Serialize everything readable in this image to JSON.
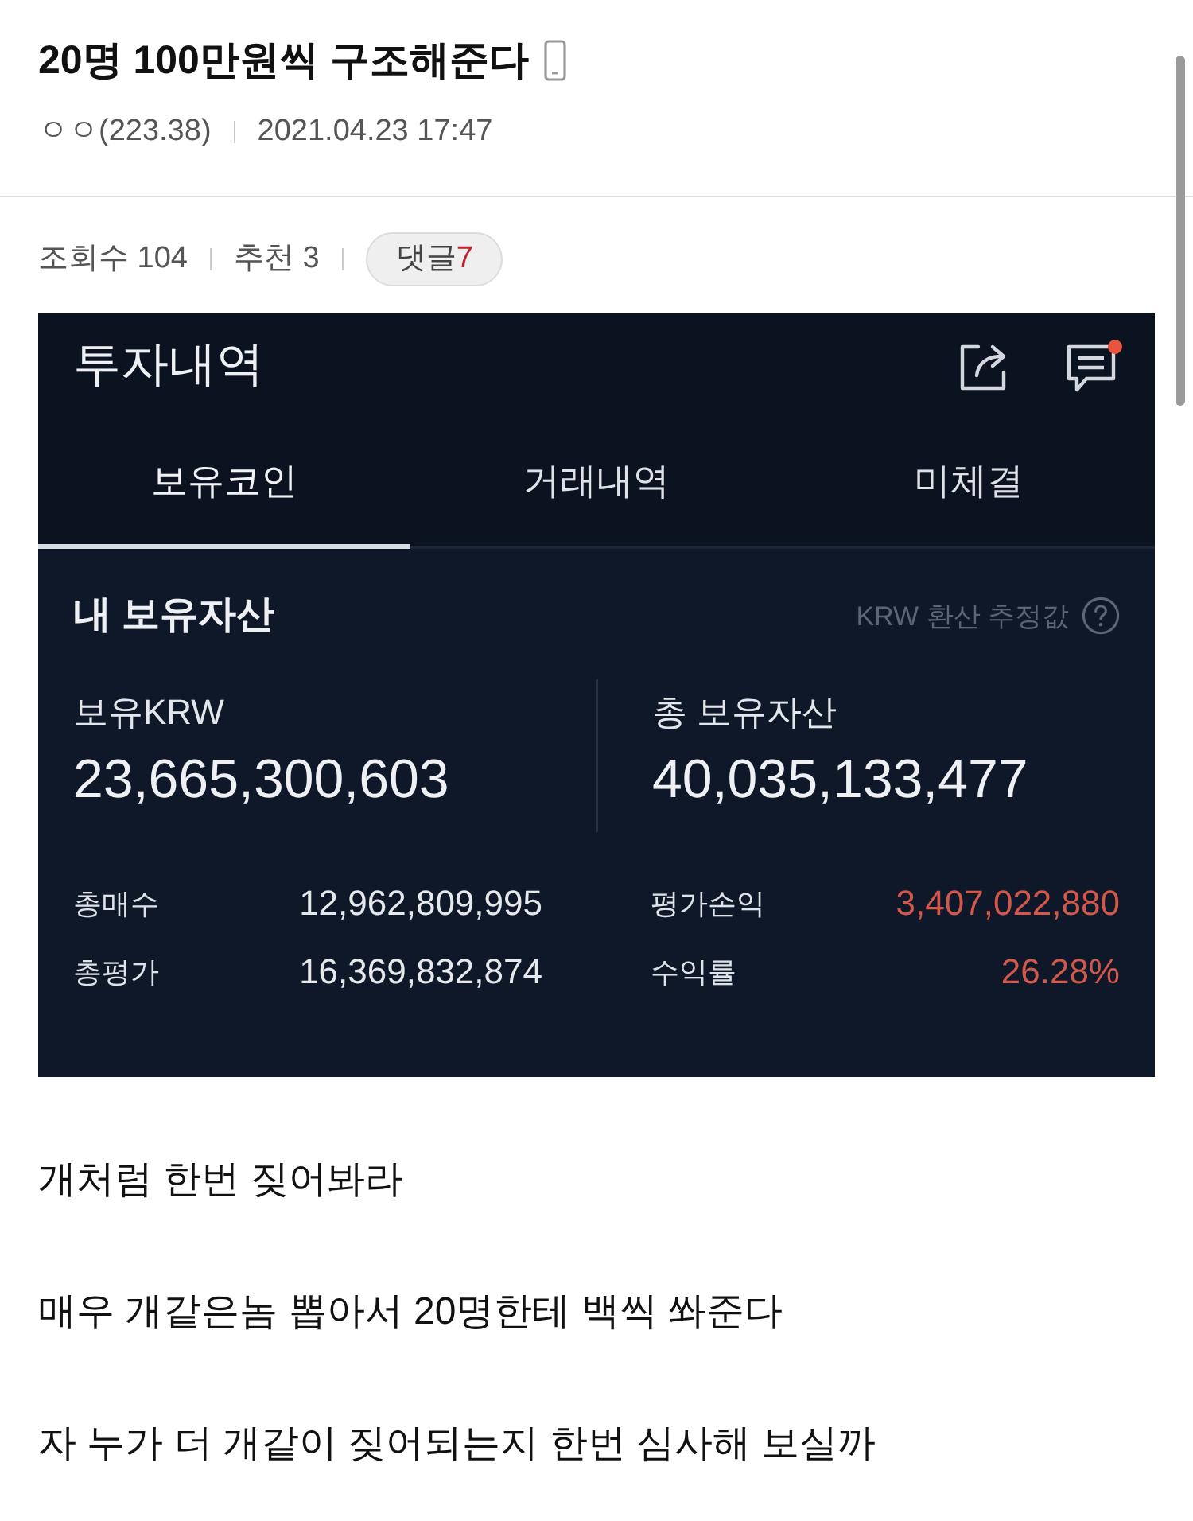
{
  "post": {
    "title": "20명 100만원씩 구조해준다",
    "author": "ㅇㅇ(223.38)",
    "date": "2021.04.23 17:47"
  },
  "stats": {
    "views": "조회수 104",
    "recommends": "추천 3",
    "comments_label": "댓글",
    "comments_count": "7"
  },
  "embedded_screenshot": {
    "title": "투자내역",
    "chat_unread": true,
    "tabs": [
      {
        "label": "보유코인",
        "selected": true
      },
      {
        "label": "거래내역",
        "selected": false
      },
      {
        "label": "미체결",
        "selected": false
      }
    ],
    "summary": {
      "title": "내 보유자산",
      "note": "KRW 환산 추정값",
      "columns": [
        {
          "label": "보유KRW",
          "value": "23,665,300,603",
          "details": [
            {
              "label": "총매수",
              "value": "12,962,809,995",
              "color": "#e6e8ec"
            },
            {
              "label": "총평가",
              "value": "16,369,832,874",
              "color": "#e6e8ec"
            }
          ]
        },
        {
          "label": "총 보유자산",
          "value": "40,035,133,477",
          "details": [
            {
              "label": "평가손익",
              "value": "3,407,022,880",
              "color": "#d2584b"
            },
            {
              "label": "수익률",
              "value": "26.28%",
              "color": "#d2584b"
            }
          ]
        }
      ]
    }
  },
  "body": [
    "개처럼 한번 짖어봐라",
    "매우 개같은놈 뽑아서 20명한테 백씩 쏴준다",
    "자 누가 더 개같이 짖어되는지 한번 심사해 보실까"
  ]
}
